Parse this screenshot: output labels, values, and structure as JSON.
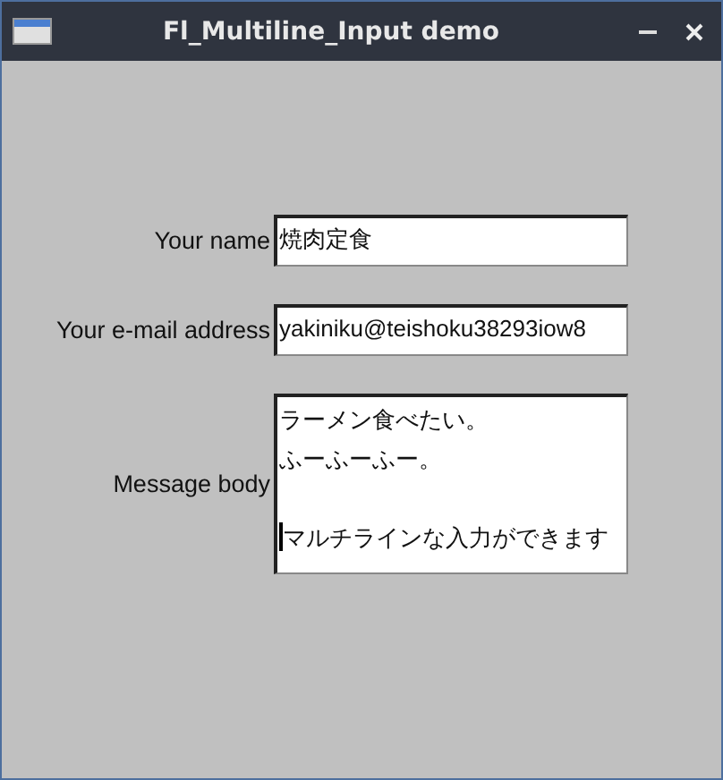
{
  "window": {
    "title": "Fl_Multiline_Input demo"
  },
  "fields": [
    {
      "kind": "single",
      "label": "Your name",
      "value": "焼肉定食"
    },
    {
      "kind": "single",
      "label": "Your e-mail address",
      "value": "yakiniku@teishoku38293iow8"
    },
    {
      "kind": "multi",
      "label": "Message body",
      "lines": [
        {
          "text": "ラーメン食べたい。",
          "spaced": false
        },
        {
          "text": "ふーふーふー。",
          "spaced": false
        },
        {
          "text": "マルチラインな入力ができます",
          "spaced": true
        }
      ]
    }
  ]
}
